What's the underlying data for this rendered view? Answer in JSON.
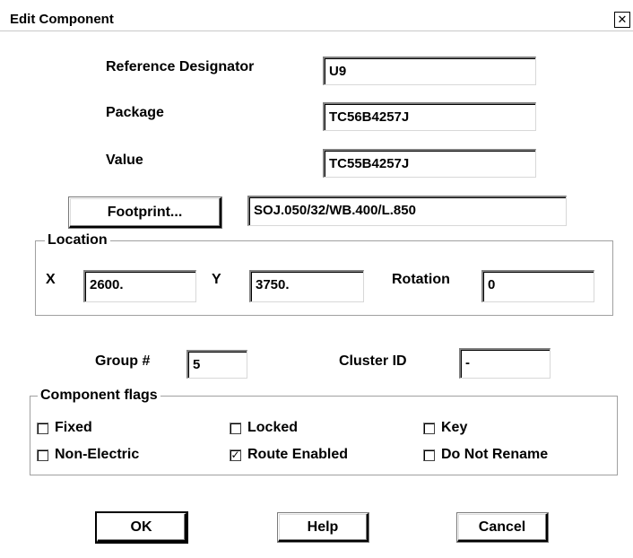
{
  "window": {
    "title": "Edit Component",
    "close_glyph": "✕"
  },
  "fields": {
    "reference_designator": {
      "label": "Reference Designator",
      "value": "U9"
    },
    "package": {
      "label": "Package",
      "value": "TC56B4257J"
    },
    "value": {
      "label": "Value",
      "value": "TC55B4257J"
    },
    "footprint": {
      "button_label": "Footprint...",
      "value": "SOJ.050/32/WB.400/L.850"
    }
  },
  "location": {
    "title": "Location",
    "x": {
      "label": "X",
      "value": "2600."
    },
    "y": {
      "label": "Y",
      "value": "3750."
    },
    "rotation": {
      "label": "Rotation",
      "value": "0"
    }
  },
  "group": {
    "label": "Group #",
    "value": "5"
  },
  "cluster": {
    "label": "Cluster ID",
    "value": "-"
  },
  "component_flags": {
    "title": "Component flags",
    "items": [
      {
        "label": "Fixed",
        "checked": false
      },
      {
        "label": "Locked",
        "checked": false
      },
      {
        "label": "Key",
        "checked": false
      },
      {
        "label": "Non-Electric",
        "checked": false
      },
      {
        "label": "Route Enabled",
        "checked": true
      },
      {
        "label": "Do Not Rename",
        "checked": false
      }
    ],
    "check_glyph": "✓"
  },
  "buttons": {
    "ok": "OK",
    "help": "Help",
    "cancel": "Cancel"
  }
}
